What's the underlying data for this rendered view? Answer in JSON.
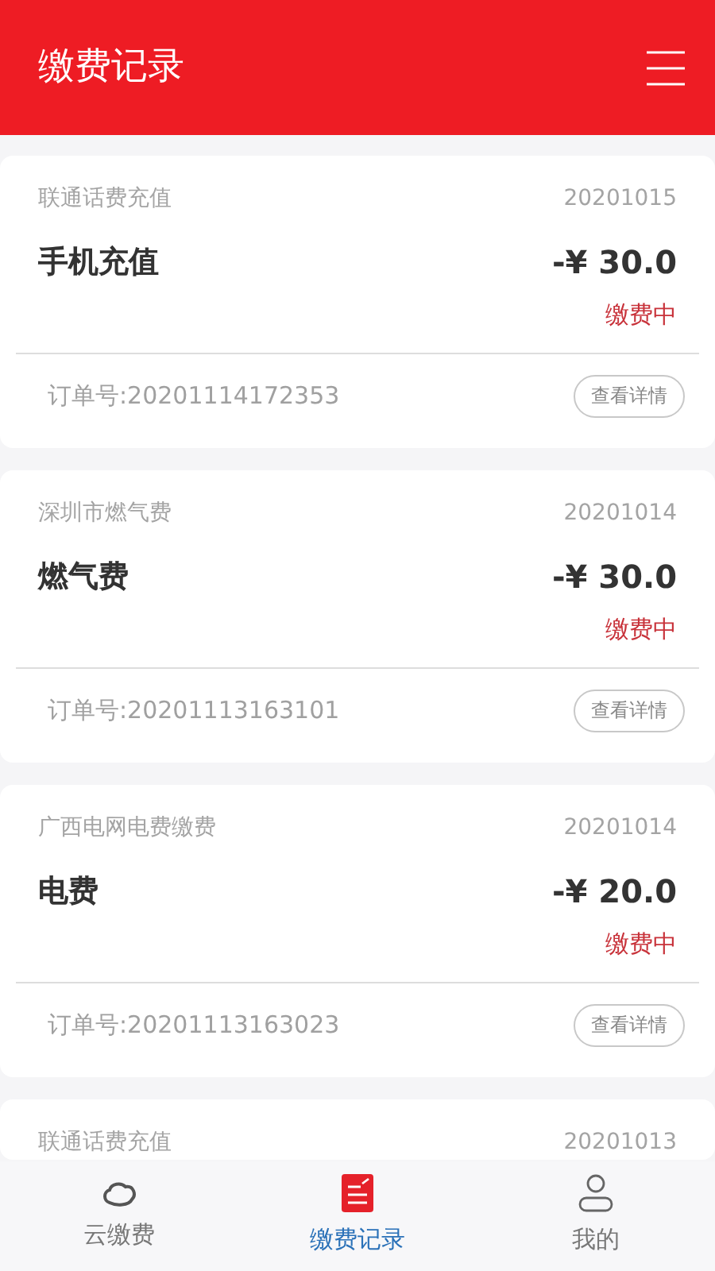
{
  "header": {
    "title": "缴费记录"
  },
  "records": [
    {
      "source": "联通话费充值",
      "date": "20201015",
      "name": "手机充值",
      "amount": "-¥ 30.0",
      "status": "缴费中",
      "order": "订单号:20201114172353",
      "button": "查看详情"
    },
    {
      "source": "深圳市燃气费",
      "date": "20201014",
      "name": "燃气费",
      "amount": "-¥ 30.0",
      "status": "缴费中",
      "order": "订单号:20201113163101",
      "button": "查看详情"
    },
    {
      "source": "广西电网电费缴费",
      "date": "20201014",
      "name": "电费",
      "amount": "-¥ 20.0",
      "status": "缴费中",
      "order": "订单号:20201113163023",
      "button": "查看详情"
    },
    {
      "source": "联通话费充值",
      "date": "20201013"
    }
  ],
  "tabs": [
    {
      "label": "云缴费",
      "kind": "cloud",
      "selected": false
    },
    {
      "label": "缴费记录",
      "kind": "record",
      "selected": true
    },
    {
      "label": "我的",
      "kind": "user",
      "selected": false
    }
  ]
}
